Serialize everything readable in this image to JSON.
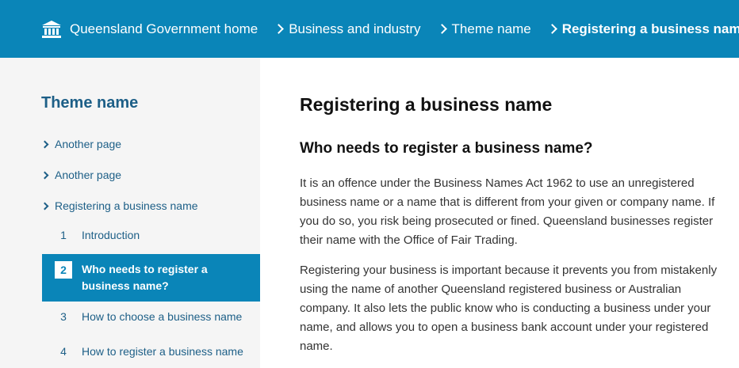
{
  "breadcrumb": {
    "home_label": "Queensland Government home",
    "items": [
      {
        "label": "Business and industry"
      },
      {
        "label": "Theme name"
      },
      {
        "label": "Registering a business name"
      }
    ]
  },
  "sidebar": {
    "title": "Theme name",
    "nav": [
      {
        "label": "Another page"
      },
      {
        "label": "Another page"
      },
      {
        "label": "Registering a business name"
      }
    ],
    "steps": [
      {
        "num": "1",
        "label": "Introduction"
      },
      {
        "num": "2",
        "label": "Who needs to register a business name?"
      },
      {
        "num": "3",
        "label": "How to choose a business name"
      },
      {
        "num": "4",
        "label": "How to register a business name"
      }
    ]
  },
  "main": {
    "title": "Registering a business name",
    "subtitle": "Who needs to register a business name?",
    "paragraphs": [
      "It is an offence under the Business Names Act 1962 to use an unregistered business name or a name that is different from your given or company name. If you do so, you risk being prosecuted or fined. Queensland businesses register their name with the Office of Fair Trading.",
      "Registering your business is important because it prevents you from mistakenly using the name of another Queensland registered business or Australian company. It also lets the public know who is conducting a business under your name, and allows you to open a business bank account under your registered name."
    ]
  },
  "colors": {
    "header_bg": "#0a85b8",
    "sidebar_bg": "#f5f5f5",
    "link": "#1d5f87",
    "active_step_bg": "#0a85b8"
  },
  "icons": {
    "home": "government-building-icon",
    "separator": "chevron-right-icon"
  },
  "state": {
    "active_step": "2"
  }
}
